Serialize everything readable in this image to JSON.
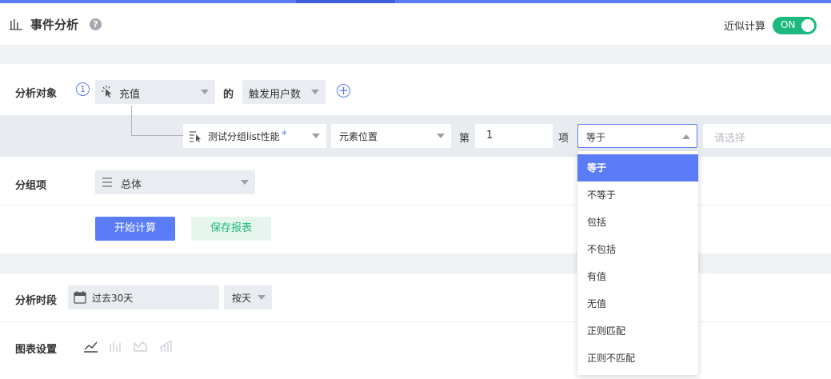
{
  "header": {
    "title": "事件分析",
    "help": "?",
    "approx_label": "近似计算",
    "toggle_label": "ON"
  },
  "analysis": {
    "label": "分析对象",
    "step": "1",
    "event": "充值",
    "of": "的",
    "metric": "触发用户数"
  },
  "filter": {
    "property": "测试分组list性能",
    "required_mark": "*",
    "position": "元素位置",
    "di": "第",
    "index": "1",
    "xiang": "项",
    "operator": "等于",
    "value_placeholder": "请选择"
  },
  "group": {
    "label": "分组项",
    "value": "总体"
  },
  "actions": {
    "start": "开始计算",
    "save": "保存报表"
  },
  "period": {
    "label": "分析时段",
    "range": "过去30天",
    "granularity": "按天"
  },
  "chart": {
    "label": "图表设置"
  },
  "dropdown": {
    "options": [
      "等于",
      "不等于",
      "包括",
      "不包括",
      "有值",
      "无值",
      "正则匹配",
      "正则不匹配"
    ],
    "selected": "等于"
  },
  "colors": {
    "primary": "#5b7cf7",
    "success": "#1cb87e"
  }
}
